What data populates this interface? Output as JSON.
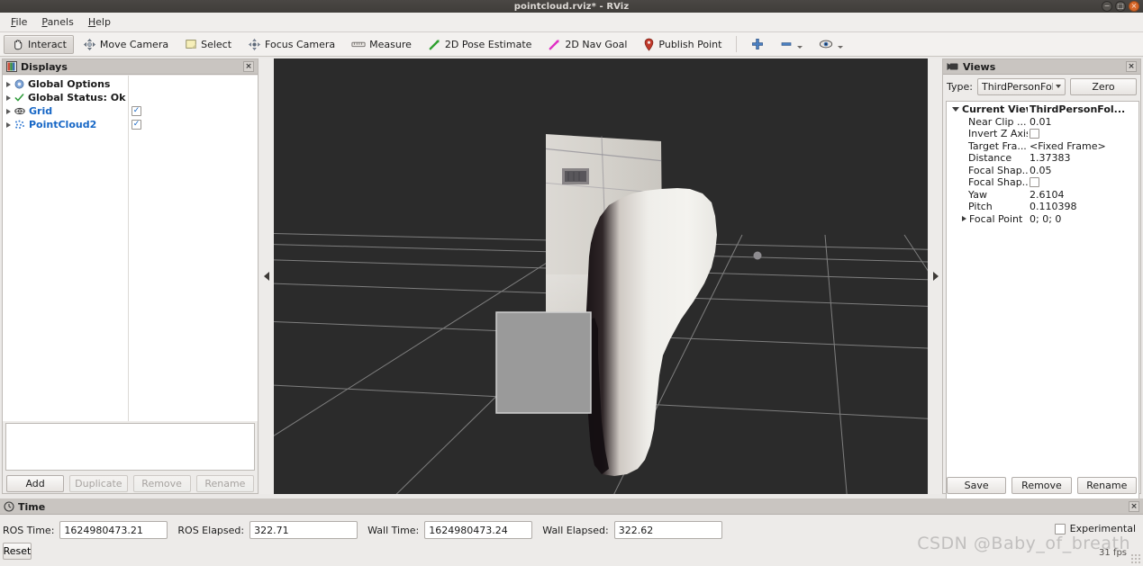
{
  "window": {
    "title": "pointcloud.rviz* - RViz",
    "controls": [
      {
        "name": "minimize",
        "glyph": "−"
      },
      {
        "name": "maximize",
        "glyph": "□"
      },
      {
        "name": "close",
        "glyph": "×"
      }
    ]
  },
  "menubar": {
    "items": [
      {
        "label": "File",
        "mnemonic": "F"
      },
      {
        "label": "Panels",
        "mnemonic": "P"
      },
      {
        "label": "Help",
        "mnemonic": "H"
      }
    ]
  },
  "toolbar": {
    "buttons": [
      {
        "label": "Interact",
        "icon": "hand-icon",
        "active": true
      },
      {
        "label": "Move Camera",
        "icon": "move-camera-icon",
        "active": false
      },
      {
        "label": "Select",
        "icon": "select-rect-icon",
        "active": false
      },
      {
        "label": "Focus Camera",
        "icon": "focus-camera-icon",
        "active": false
      },
      {
        "label": "Measure",
        "icon": "measure-icon",
        "active": false
      },
      {
        "label": "2D Pose Estimate",
        "icon": "pose-estimate-arrow-icon",
        "active": false
      },
      {
        "label": "2D Nav Goal",
        "icon": "nav-goal-arrow-icon",
        "active": false
      },
      {
        "label": "Publish Point",
        "icon": "map-pin-icon",
        "active": false
      }
    ],
    "tool_actions": [
      {
        "name": "add-tool-icon",
        "glyph": "plus"
      },
      {
        "name": "remove-tool-icon",
        "glyph": "minus"
      },
      {
        "name": "tool-visibility-icon",
        "glyph": "eye"
      }
    ]
  },
  "displays": {
    "title": "Displays",
    "title_icon": "displays-icon",
    "close_glyph": "×",
    "tree": [
      {
        "label": "Global Options",
        "icon": "gear-icon",
        "link": false,
        "checkbox": null
      },
      {
        "label": "Global Status: Ok",
        "icon": "check-icon",
        "link": false,
        "checkbox": null
      },
      {
        "label": "Grid",
        "icon": "grid-eye-icon",
        "link": true,
        "checkbox": true
      },
      {
        "label": "PointCloud2",
        "icon": "pointcloud-icon",
        "link": true,
        "checkbox": true
      }
    ],
    "buttons": [
      {
        "label": "Add",
        "enabled": true
      },
      {
        "label": "Duplicate",
        "enabled": false
      },
      {
        "label": "Remove",
        "enabled": false
      },
      {
        "label": "Rename",
        "enabled": false
      }
    ]
  },
  "views": {
    "title": "Views",
    "title_icon": "camera-icon",
    "close_glyph": "×",
    "type_label": "Type:",
    "type_value": "ThirdPersonFollo",
    "zero_label": "Zero",
    "properties": [
      {
        "key": "Current View",
        "value": "ThirdPersonFol...",
        "expander": "down",
        "bold": true,
        "type": "text"
      },
      {
        "key": "Near Clip ...",
        "value": "0.01",
        "expander": "none",
        "bold": false,
        "type": "text"
      },
      {
        "key": "Invert Z Axis",
        "value": "",
        "expander": "none",
        "bold": false,
        "type": "checkbox"
      },
      {
        "key": "Target Fra...",
        "value": "<Fixed Frame>",
        "expander": "none",
        "bold": false,
        "type": "text"
      },
      {
        "key": "Distance",
        "value": "1.37383",
        "expander": "none",
        "bold": false,
        "type": "text"
      },
      {
        "key": "Focal Shap...",
        "value": "0.05",
        "expander": "none",
        "bold": false,
        "type": "text"
      },
      {
        "key": "Focal Shap...",
        "value": "",
        "expander": "none",
        "bold": false,
        "type": "checkbox"
      },
      {
        "key": "Yaw",
        "value": "2.6104",
        "expander": "none",
        "bold": false,
        "type": "text"
      },
      {
        "key": "Pitch",
        "value": "0.110398",
        "expander": "none",
        "bold": false,
        "type": "text"
      },
      {
        "key": "Focal Point",
        "value": "0; 0; 0",
        "expander": "right",
        "bold": false,
        "type": "text"
      }
    ],
    "buttons": [
      {
        "label": "Save",
        "enabled": true
      },
      {
        "label": "Remove",
        "enabled": true
      },
      {
        "label": "Rename",
        "enabled": true
      }
    ]
  },
  "time": {
    "title": "Time",
    "title_icon": "clock-icon",
    "close_glyph": "×",
    "fields": [
      {
        "label": "ROS Time:",
        "value": "1624980473.21"
      },
      {
        "label": "ROS Elapsed:",
        "value": "322.71"
      },
      {
        "label": "Wall Time:",
        "value": "1624980473.24"
      },
      {
        "label": "Wall Elapsed:",
        "value": "322.62"
      }
    ],
    "reset_label": "Reset",
    "experimental_label": "Experimental",
    "experimental_checked": false
  },
  "viewport": {
    "background_color": "#2b2b2b",
    "grid_color": "#8f8f8f",
    "selection_rect_color": "#999999",
    "fps": "31 fps"
  },
  "splitters": {
    "left_glyph": "◀",
    "right_glyph": "▶"
  },
  "watermark": "CSDN @Baby_of_breath"
}
